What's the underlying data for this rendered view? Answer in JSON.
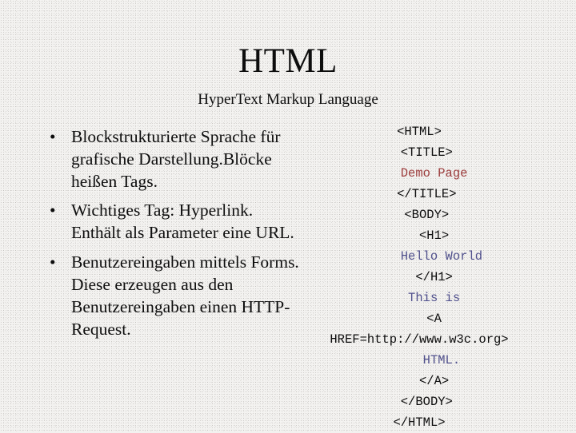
{
  "slide": {
    "title": "HTML",
    "subtitle": "HyperText Markup Language",
    "background_color": "#f2f1ef",
    "text_color": "#0d0d0d"
  },
  "bullets": {
    "marker": "•",
    "items": [
      {
        "text": "Blockstrukturierte Sprache für grafische Darstellung.Blöcke heißen Tags."
      },
      {
        "text": "Wichtiges Tag: Hyperlink. Enthält als Parameter eine URL."
      },
      {
        "text": "Benutzereingaben mittels Forms. Diese erzeugen aus den Benutzereingaben einen HTTP-Request."
      }
    ]
  },
  "code": {
    "colors": {
      "default": "#0d0d0d",
      "red": "#9c3c3c",
      "blue": "#50508c"
    },
    "lines": [
      {
        "text": "<HTML>",
        "color": "default"
      },
      {
        "text": "  <TITLE>",
        "color": "default"
      },
      {
        "text": "    Demo Page",
        "color": "red"
      },
      {
        "text": "  </TITLE>",
        "color": "default"
      },
      {
        "text": "  <BODY>",
        "color": "default"
      },
      {
        "text": "    <H1>",
        "color": "default"
      },
      {
        "text": "      Hello World",
        "color": "blue"
      },
      {
        "text": "    </H1>",
        "color": "default"
      },
      {
        "text": "    This is",
        "color": "blue"
      },
      {
        "text": "    <A",
        "color": "default"
      },
      {
        "text": "HREF=http://www.w3c.org>",
        "color": "default"
      },
      {
        "text": "      HTML.",
        "color": "blue"
      },
      {
        "text": "    </A>",
        "color": "default"
      },
      {
        "text": "  </BODY>",
        "color": "default"
      },
      {
        "text": "</HTML>",
        "color": "default"
      }
    ]
  }
}
